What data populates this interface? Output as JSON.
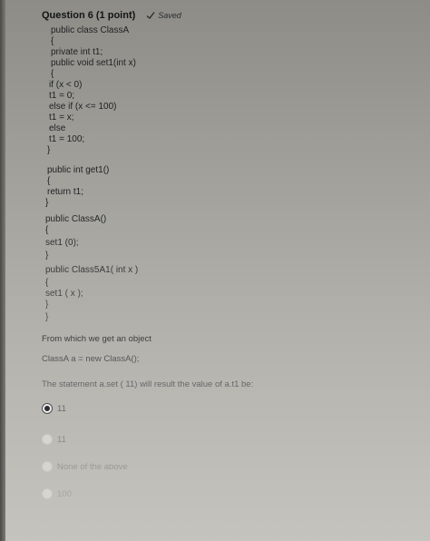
{
  "question": {
    "title": "Question 6 (1 point)",
    "status": "Saved",
    "status_icon": "check-icon"
  },
  "code": {
    "lines": [
      "public class ClassA",
      "{",
      "private int t1;",
      "public void set1(int x)",
      "{",
      "if (x < 0)",
      "t1 = 0;",
      "else if (x <= 100)",
      "t1 = x;",
      "else",
      "t1 = 100;",
      "}",
      "public int get1()",
      "{",
      "return t1;",
      "}",
      "public ClassA()",
      "{",
      "set1 (0);",
      "}",
      "public Class5A1( int x )",
      "{",
      "set1 ( x );",
      "}",
      "}"
    ]
  },
  "prompt": {
    "intro": "From which we get an object",
    "statement": "ClassA a = new ClassA();",
    "question": "The statement a.set ( 11) will result the value of a.t1 be:"
  },
  "options": [
    {
      "label": "11",
      "selected": true
    },
    {
      "label": "11",
      "selected": false
    },
    {
      "label": "None of the above",
      "selected": false
    },
    {
      "label": "100",
      "selected": false
    }
  ],
  "colors": {
    "text": "#1b1d20",
    "faded_text": "#6e6e6b",
    "radio_checked": "#2a2c2f"
  }
}
